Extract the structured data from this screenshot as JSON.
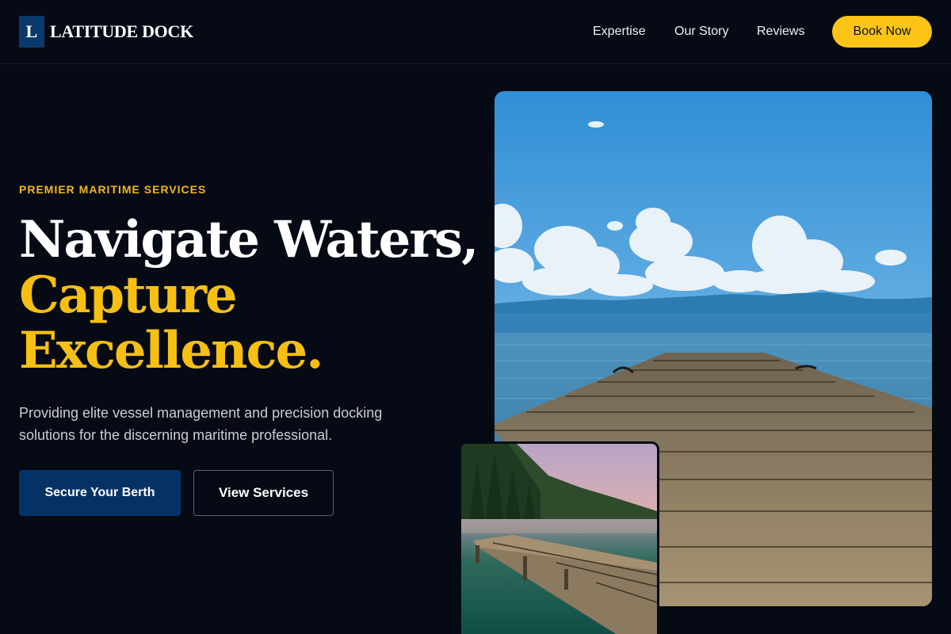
{
  "brand": {
    "mark": "L",
    "name": "LATITUDE DOCK"
  },
  "nav": {
    "links": [
      "Expertise",
      "Our Story",
      "Reviews"
    ],
    "cta": "Book Now"
  },
  "hero": {
    "eyebrow": "PREMIER MARITIME SERVICES",
    "headline_line1": "Navigate Waters,",
    "headline_line2": "Capture",
    "headline_line3": "Excellence.",
    "subcopy": "Providing elite vessel management and precision docking solutions for the discerning maritime professional.",
    "primary_cta": "Secure Your Berth",
    "secondary_cta": "View Services"
  },
  "colors": {
    "background": "#060a14",
    "accent_gold": "#fcc417",
    "brand_navy": "#053266"
  },
  "images": {
    "main": "lake-pier-photo",
    "inset": "forest-lake-dock-photo"
  }
}
